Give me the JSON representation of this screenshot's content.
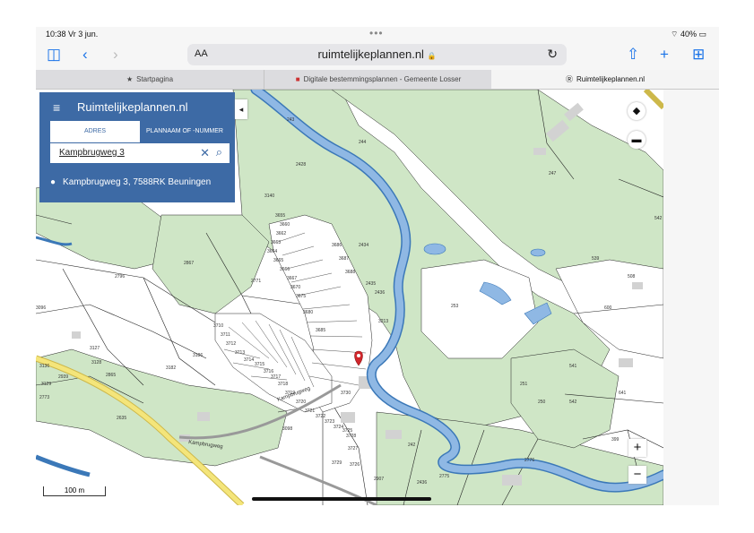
{
  "status": {
    "time": "10:38  Vr 3 jun.",
    "dots": "•••",
    "battery": "40%"
  },
  "browser": {
    "aa": "AA",
    "url": "ruimtelijkeplannen.nl",
    "url_lock": "🔒"
  },
  "tabs": [
    {
      "label": "Startpagina"
    },
    {
      "label": "Digitale bestemmingsplannen - Gemeente Losser"
    },
    {
      "label": "Ruimtelijkeplannen.nl"
    }
  ],
  "panel": {
    "title": "Ruimtelijkeplannen.nl",
    "tab_adres": "ADRES",
    "tab_plan": "PLANNAAM OF -NUMMER",
    "search_value": "Kampbrugweg 3",
    "result": "Kampbrugweg 3, 7588RK Beuningen"
  },
  "map": {
    "scale": "100 m",
    "zoom_in": "+",
    "zoom_out": "−",
    "road_label": "Kampbrugweg",
    "road_label_2": "Kampbrugweg",
    "parcels": [
      "243",
      "244",
      "2428",
      "3140",
      "247",
      "542",
      "3096",
      "2796",
      "2867",
      "2771",
      "3182",
      "2865",
      "3128",
      "3127",
      "2635",
      "3098",
      "2434",
      "2435",
      "2436",
      "253",
      "3213",
      "539",
      "508",
      "600",
      "541",
      "641",
      "542",
      "251",
      "250",
      "3730",
      "3728",
      "3727",
      "3726",
      "3729",
      "2436",
      "2775",
      "2776",
      "399",
      "3173",
      "3655",
      "3660",
      "3662",
      "3663",
      "3664",
      "3665",
      "3666",
      "3667",
      "3670",
      "3675",
      "3680",
      "3685",
      "3686",
      "3687",
      "3688",
      "3710",
      "3711",
      "3712",
      "3713",
      "3714",
      "3715",
      "3716",
      "3717",
      "3718",
      "3719",
      "3720",
      "3721",
      "3722",
      "3723",
      "3724",
      "3725",
      "3186",
      "3136",
      "3129",
      "2773",
      "2939",
      "2907",
      "242"
    ],
    "colors": {
      "water": "#8fb8e4",
      "water_stroke": "#3b78b8",
      "forest": "#cfe6c6",
      "road": "#f4e57a",
      "road_stroke": "#cdb84a",
      "parcel_stroke": "#222222",
      "panel": "#3d6aa5",
      "marker": "#d0262b"
    }
  }
}
